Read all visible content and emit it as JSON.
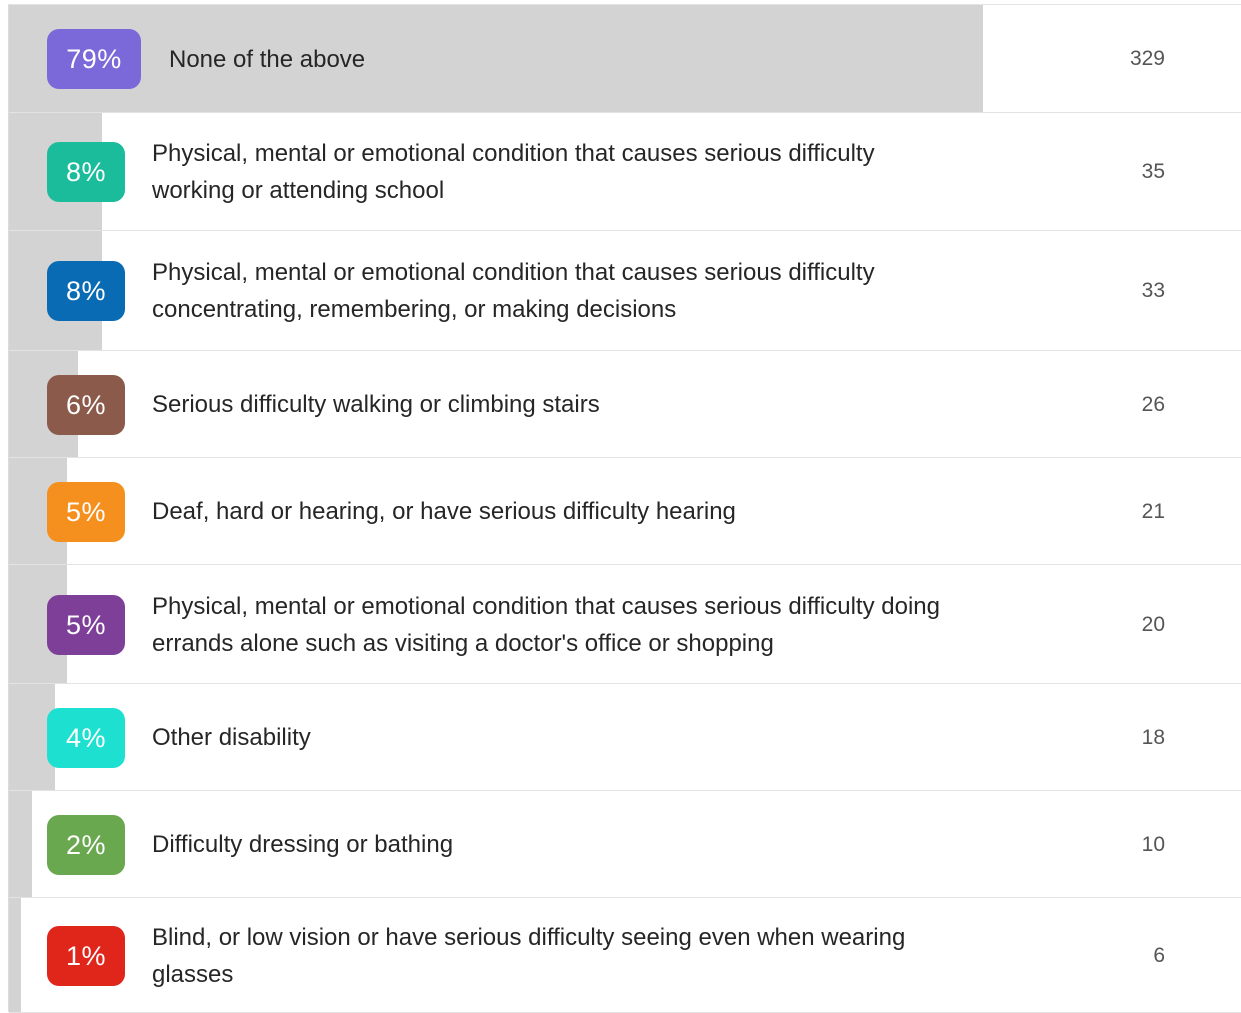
{
  "chart_data": {
    "type": "bar",
    "items": [
      {
        "percent_label": "79%",
        "label": "None of the above",
        "count": "329",
        "color": "#7b68d9",
        "value": 79
      },
      {
        "percent_label": "8%",
        "label": "Physical, mental or emotional condition that causes serious difficulty working or attending school",
        "count": "35",
        "color": "#1abc9c",
        "value": 8
      },
      {
        "percent_label": "8%",
        "label": "Physical, mental or emotional condition that causes serious difficulty concentrating, remembering, or making decisions",
        "count": "33",
        "color": "#0a6bb5",
        "value": 8
      },
      {
        "percent_label": "6%",
        "label": "Serious difficulty walking or climbing stairs",
        "count": "26",
        "color": "#8b5a4a",
        "value": 6
      },
      {
        "percent_label": "5%",
        "label": "Deaf, hard or hearing, or have serious difficulty hearing",
        "count": "21",
        "color": "#f5901e",
        "value": 5
      },
      {
        "percent_label": "5%",
        "label": "Physical, mental or emotional condition that causes serious difficulty doing errands alone such as visiting a doctor's office or shopping",
        "count": "20",
        "color": "#7d3f98",
        "value": 5
      },
      {
        "percent_label": "4%",
        "label": "Other disability",
        "count": "18",
        "color": "#1ee0d0",
        "value": 4
      },
      {
        "percent_label": "2%",
        "label": "Difficulty dressing or bathing",
        "count": "10",
        "color": "#6aa84f",
        "value": 2
      },
      {
        "percent_label": "1%",
        "label": "Blind, or low vision or have serious difficulty seeing even when wearing glasses",
        "count": "6",
        "color": "#e0251b",
        "value": 1
      }
    ]
  }
}
